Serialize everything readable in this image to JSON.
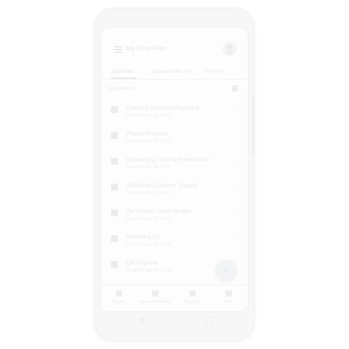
{
  "header": {
    "title": "My Drive Files",
    "menu_icon": "menu-icon",
    "action_icon": "upload-icon"
  },
  "tabs": [
    {
      "label": "My Files",
      "active": true
    },
    {
      "label": "Shared with me",
      "active": false
    },
    {
      "label": "Recent",
      "active": false
    }
  ],
  "section": {
    "label": "Documents",
    "toggle_icon": "grid-view-icon"
  },
  "files": [
    {
      "name": "Quarterly Financial Reporting",
      "meta": "Modified Jan 23, 2023",
      "icon": "document-icon"
    },
    {
      "name": "Project Proposal",
      "meta": "Modified Jan 18, 2023",
      "icon": "document-icon"
    },
    {
      "name": "Onboarding Training Presentation",
      "meta": "Modified Jan 16, 2023",
      "icon": "document-icon"
    },
    {
      "name": "Additional Customer Support",
      "meta": "Modified Jan 14, 2023",
      "icon": "document-icon"
    },
    {
      "name": "Tax Return - Sales Budget",
      "meta": "Modified Jan 12, 2023",
      "icon": "document-icon"
    },
    {
      "name": "Marketing Q4",
      "meta": "Modified Jan 10, 2023",
      "icon": "document-icon"
    },
    {
      "name": "Q4 Proposal",
      "meta": "Modified Jan 08, 2023",
      "icon": "document-icon"
    }
  ],
  "fab": {
    "label": "+",
    "icon": "add-icon"
  },
  "bottom_nav": [
    {
      "label": "Home",
      "icon": "home-icon"
    },
    {
      "label": "Recommended",
      "icon": "people-icon"
    },
    {
      "label": "Shared",
      "icon": "shared-icon"
    },
    {
      "label": "Files",
      "icon": "folder-icon"
    }
  ],
  "colors": {
    "screen_bg": "#fdfdfd",
    "frame_bg": "#f7f7f8",
    "text_faint": "#e9e9ec"
  }
}
